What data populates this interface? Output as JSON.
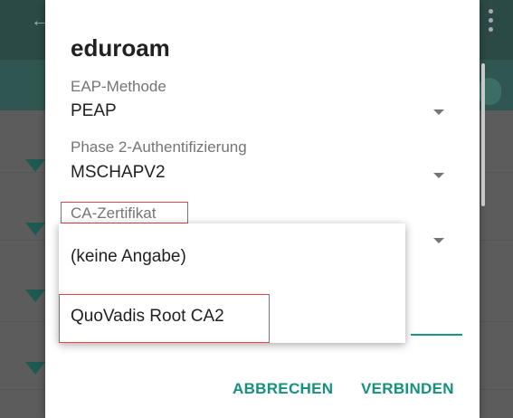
{
  "dialog": {
    "title": "eduroam",
    "fields": [
      {
        "label": "EAP-Methode",
        "value": "PEAP"
      },
      {
        "label": "Phase 2-Authentifizierung",
        "value": "MSCHAPV2"
      },
      {
        "label": "CA-Zertifikat",
        "value": ""
      }
    ],
    "actions": {
      "cancel": "ABBRECHEN",
      "connect": "VERBINDEN"
    }
  },
  "dropdown": {
    "options": [
      "(keine Angabe)",
      "QuoVadis Root CA2"
    ]
  },
  "colors": {
    "accent": "#17907c",
    "highlight": "#e8424a"
  }
}
